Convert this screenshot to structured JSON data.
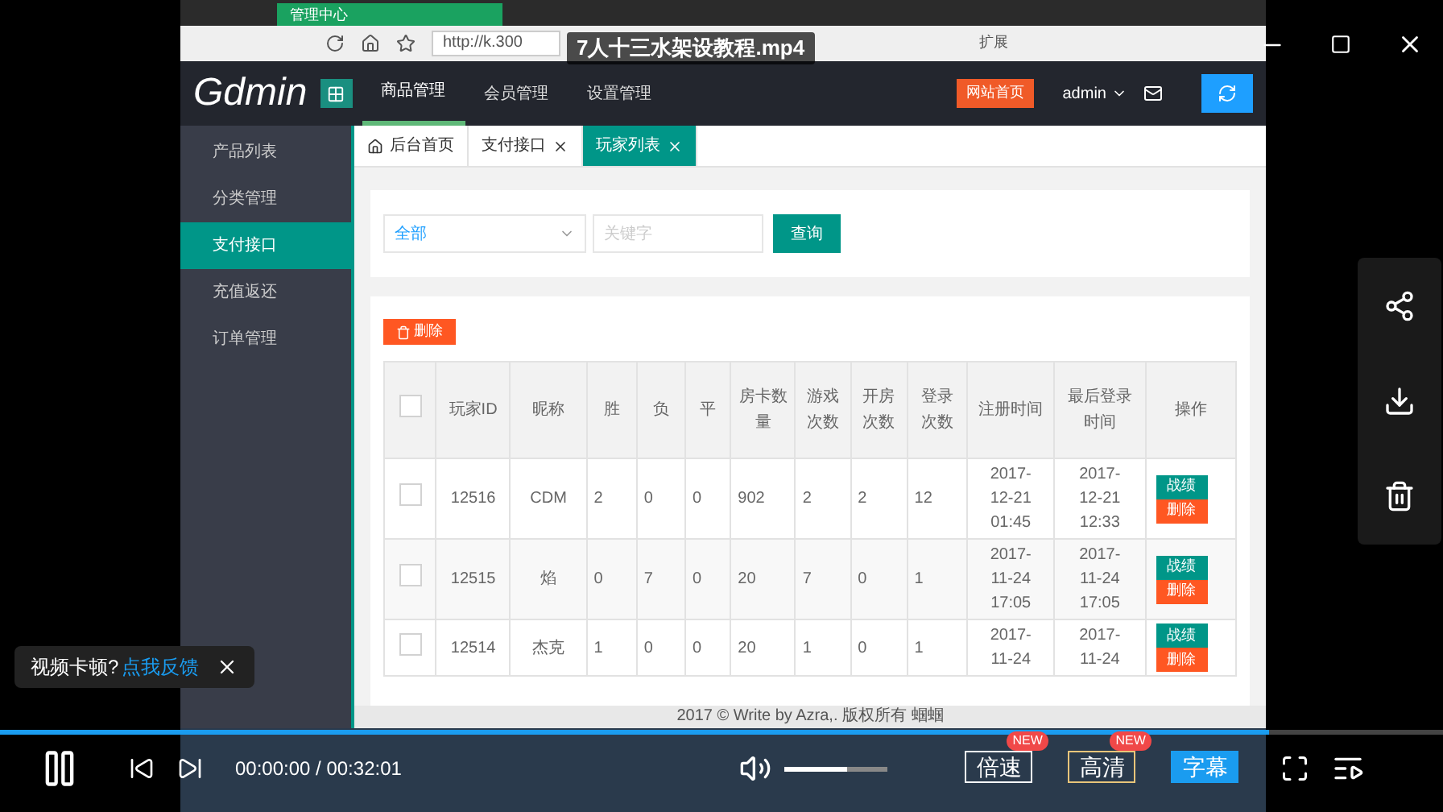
{
  "player": {
    "title": "7人十三水架设教程.mp4",
    "feedback": {
      "question": "视频卡顿?",
      "link": "点我反馈"
    },
    "progress": {
      "level": 0.88
    },
    "time": "00:00:00 / 00:32:01",
    "volume": {
      "level": 0.6
    },
    "buttons": [
      {
        "label": "倍速",
        "badge": "NEW",
        "kind": "plain"
      },
      {
        "label": "高清",
        "badge": "NEW",
        "kind": "quality"
      },
      {
        "label": "字幕",
        "kind": "filled"
      }
    ]
  },
  "browser": {
    "tab": "管理中心",
    "address": "http://k.300",
    "extensions": "扩展"
  },
  "app": {
    "brand": "Gdmin",
    "nav": [
      {
        "label": "商品管理",
        "selected": true
      },
      {
        "label": "会员管理",
        "selected": false
      },
      {
        "label": "设置管理",
        "selected": false
      }
    ],
    "site_button": "网站首页",
    "user": "admin",
    "sidebar": [
      {
        "label": "产品列表",
        "selected": false
      },
      {
        "label": "分类管理",
        "selected": false
      },
      {
        "label": "支付接口",
        "selected": true
      },
      {
        "label": "充值返还",
        "selected": false
      },
      {
        "label": "订单管理",
        "selected": false
      }
    ],
    "tabs": [
      {
        "label": "后台首页",
        "selected": false,
        "kind": "home"
      },
      {
        "label": "支付接口",
        "selected": false,
        "kind": "closable"
      },
      {
        "label": "玩家列表",
        "selected": true,
        "kind": "closable"
      }
    ],
    "filter": {
      "select": "全部",
      "placeholder": "关键字",
      "button": "查询"
    },
    "delete_button": "删除",
    "table": {
      "header_checked": false,
      "columns": [
        "玩家ID",
        "昵称",
        "胜",
        "负",
        "平",
        "房卡数量",
        "游戏次数",
        "开房次数",
        "登录次数",
        "注册时间",
        "最后登录时间",
        "操作"
      ],
      "rows": [
        {
          "checked": false,
          "cells": [
            "12516",
            "CDM",
            "2",
            "0",
            "0",
            "902",
            "2",
            "2",
            "12",
            "2017-12-21 01:45",
            "2017-12-21 12:33"
          ],
          "actions": [
            "战绩",
            "删除"
          ]
        },
        {
          "checked": false,
          "cells": [
            "12515",
            "焰",
            "0",
            "7",
            "0",
            "20",
            "7",
            "0",
            "1",
            "2017-11-24 17:05",
            "2017-11-24 17:05"
          ],
          "actions": [
            "战绩",
            "删除"
          ]
        },
        {
          "checked": false,
          "cells": [
            "12514",
            "杰克",
            "1",
            "0",
            "0",
            "20",
            "1",
            "0",
            "1",
            "2017-11-24",
            "2017-11-24"
          ],
          "actions": [
            "战绩",
            "删除"
          ]
        }
      ]
    },
    "footer": "2017 © Write by Azra,. 版权所有 蝈蝈"
  }
}
